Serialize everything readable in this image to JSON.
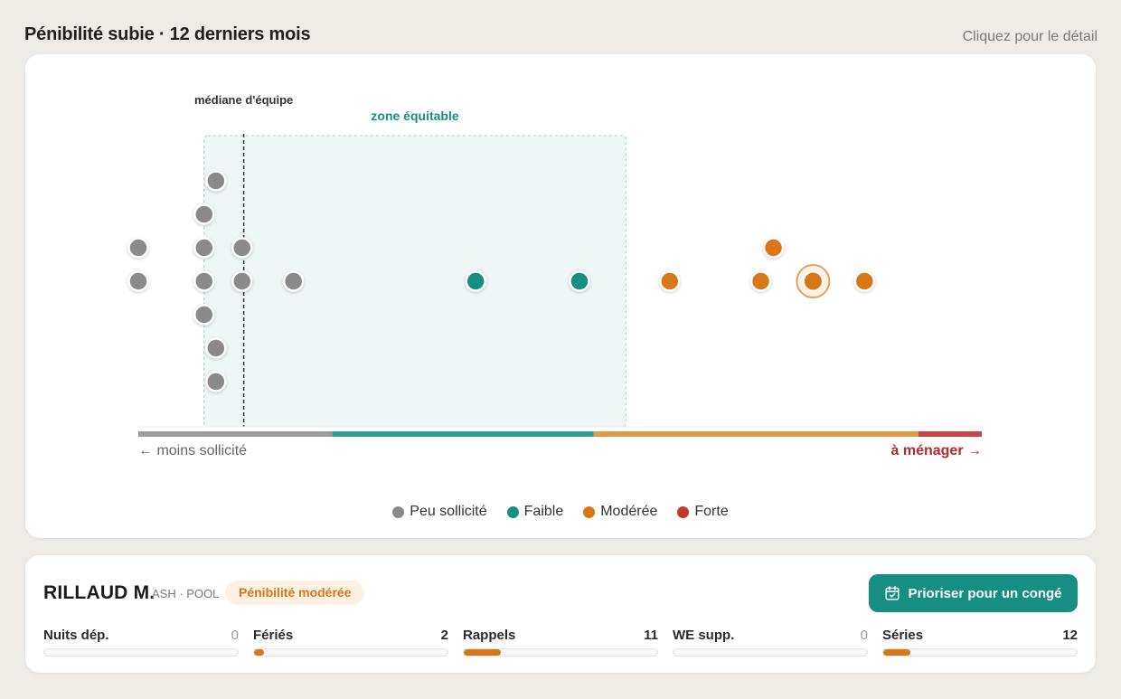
{
  "header": {
    "title": "Pénibilité subie · 12 derniers mois",
    "hint": "Cliquez pour le détail"
  },
  "chart": {
    "median_label": "médiane d'équipe",
    "zone_label": "zone équitable",
    "axis_left_label": "← moins sollicité",
    "axis_right_label": "à ménager →",
    "legend": [
      {
        "label": "Peu sollicité",
        "color": "#8a8a8a"
      },
      {
        "label": "Faible",
        "color": "#168f82"
      },
      {
        "label": "Modérée",
        "color": "#d77717"
      },
      {
        "label": "Forte",
        "color": "#c0392b"
      }
    ]
  },
  "chart_data": {
    "type": "scatter",
    "title": "",
    "xlabel": "",
    "ylabel": "",
    "scale": {
      "min": 0,
      "max": 100
    },
    "median": 12.5,
    "equitable_zone": [
      7.8,
      57.8
    ],
    "bands": [
      {
        "category": "Peu sollicité",
        "from": 0,
        "to": 23,
        "color": "#9b9b9b"
      },
      {
        "category": "Faible",
        "from": 23,
        "to": 54,
        "color": "#2e9e93"
      },
      {
        "category": "Modérée",
        "from": 54,
        "to": 92.5,
        "color": "#e29a48"
      },
      {
        "category": "Forte",
        "from": 92.5,
        "to": 100,
        "color": "#c94444"
      }
    ],
    "points": [
      {
        "x": 0,
        "lane": 1,
        "category": "Peu sollicité"
      },
      {
        "x": 0,
        "lane": 0,
        "category": "Peu sollicité"
      },
      {
        "x": 7.8,
        "lane": 2,
        "category": "Peu sollicité"
      },
      {
        "x": 7.8,
        "lane": 1,
        "category": "Peu sollicité"
      },
      {
        "x": 7.8,
        "lane": 0,
        "category": "Peu sollicité"
      },
      {
        "x": 7.8,
        "lane": -1,
        "category": "Peu sollicité"
      },
      {
        "x": 9.2,
        "lane": 3,
        "category": "Peu sollicité"
      },
      {
        "x": 9.2,
        "lane": -2,
        "category": "Peu sollicité"
      },
      {
        "x": 9.2,
        "lane": -3,
        "category": "Peu sollicité"
      },
      {
        "x": 12.3,
        "lane": 1,
        "category": "Peu sollicité"
      },
      {
        "x": 12.3,
        "lane": 0,
        "category": "Peu sollicité"
      },
      {
        "x": 18.4,
        "lane": 0,
        "category": "Peu sollicité"
      },
      {
        "x": 40,
        "lane": 0,
        "category": "Faible"
      },
      {
        "x": 52.3,
        "lane": 0,
        "category": "Faible"
      },
      {
        "x": 63,
        "lane": 0,
        "category": "Modérée"
      },
      {
        "x": 73.8,
        "lane": 0,
        "category": "Modérée"
      },
      {
        "x": 75.3,
        "lane": 1,
        "category": "Modérée"
      },
      {
        "x": 80,
        "lane": 0,
        "category": "Modérée",
        "selected": true
      },
      {
        "x": 86.1,
        "lane": 0,
        "category": "Modérée"
      }
    ]
  },
  "detail": {
    "name": "RILLAUD M.",
    "meta": "ASH · POOL",
    "badge": "Pénibilité modérée",
    "action_label": "Prioriser pour un congé",
    "metrics": [
      {
        "label": "Nuits dép.",
        "value": "0",
        "fill": 0
      },
      {
        "label": "Fériés",
        "value": "2",
        "fill": 0.05
      },
      {
        "label": "Rappels",
        "value": "11",
        "fill": 0.19
      },
      {
        "label": "WE supp.",
        "value": "0",
        "fill": 0
      },
      {
        "label": "Séries",
        "value": "12",
        "fill": 0.14
      }
    ]
  }
}
